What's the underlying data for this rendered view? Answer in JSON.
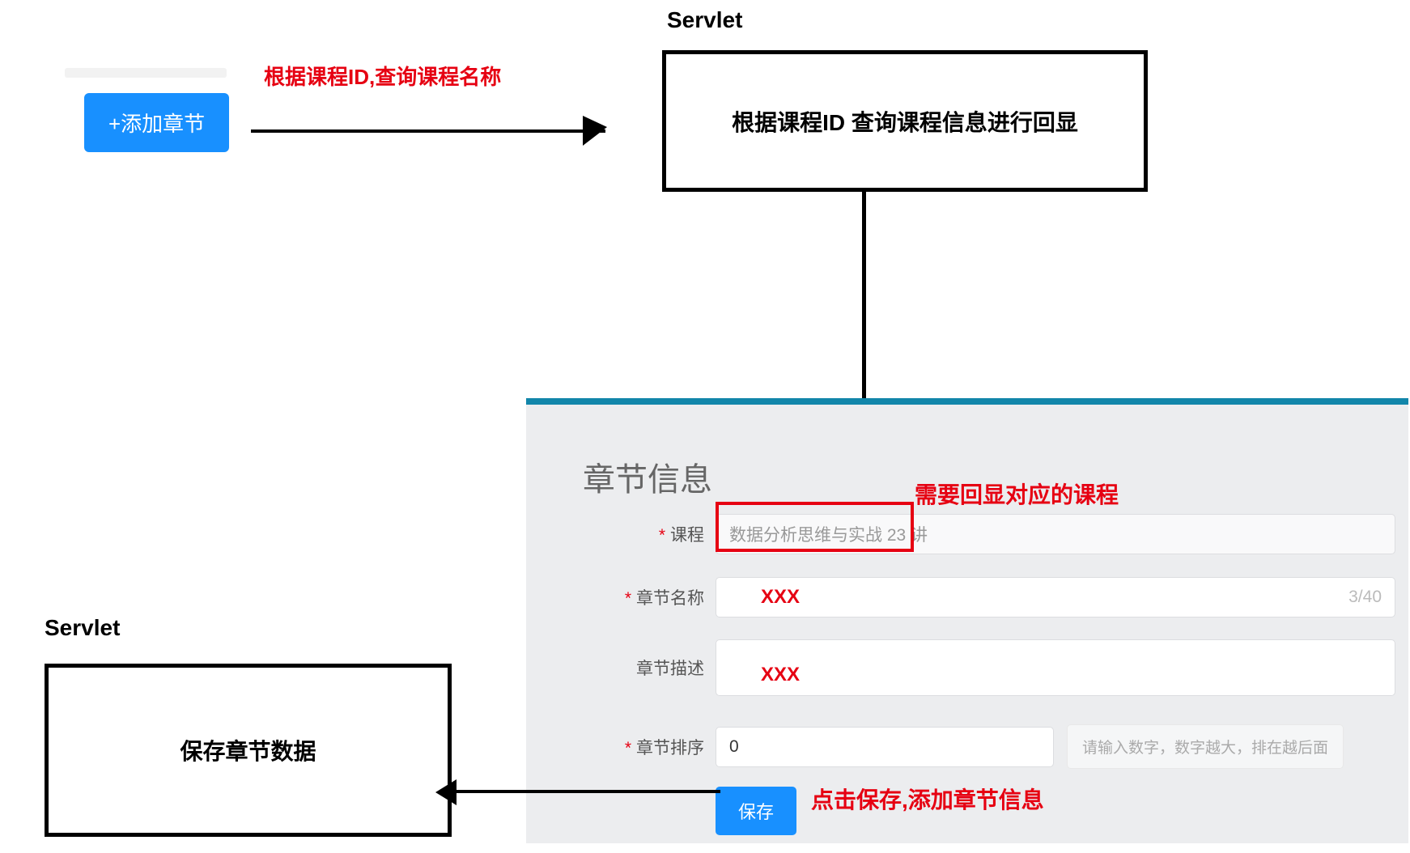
{
  "button": {
    "add_chapter": "+添加章节",
    "save": "保存"
  },
  "annotations": {
    "query_by_id": "根据课程ID,查询课程名称",
    "need_echo": "需要回显对应的课程",
    "click_save": "点击保存,添加章节信息",
    "servlet": "Servlet",
    "box1": "根据课程ID 查询课程信息进行回显",
    "box2": "保存章节数据",
    "xxx": "XXX"
  },
  "form": {
    "title": "章节信息",
    "course_label": "课程",
    "course_value": "数据分析思维与实战 23 讲",
    "chapter_name_label": "章节名称",
    "chapter_name_counter": "3/40",
    "chapter_desc_label": "章节描述",
    "chapter_order_label": "章节排序",
    "chapter_order_value": "0",
    "order_hint": "请输入数字，数字越大，排在越后面"
  }
}
